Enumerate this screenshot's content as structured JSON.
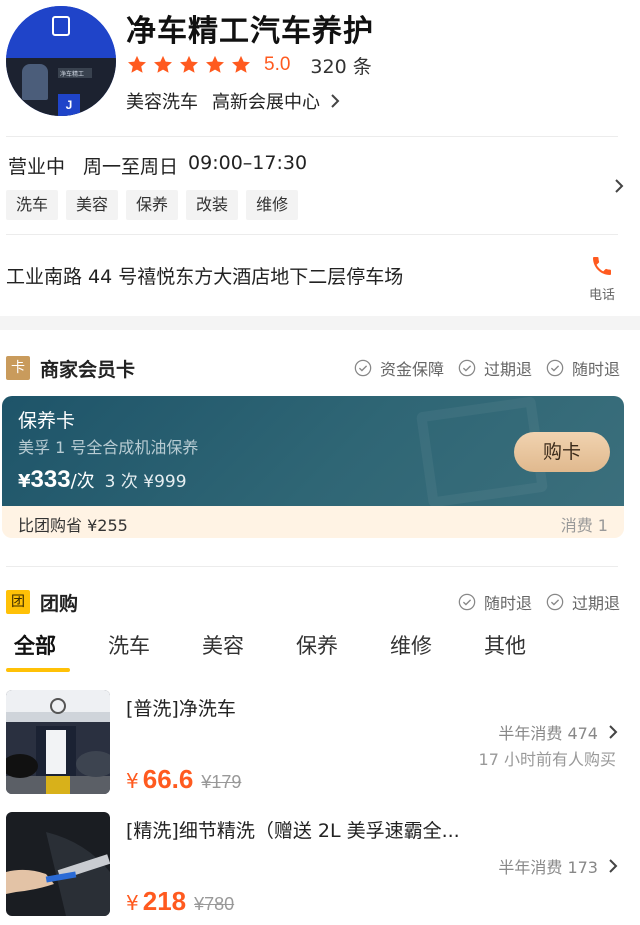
{
  "shop": {
    "name": "净车精工汽车养护",
    "rating": "5.0",
    "stars": 5,
    "reviews": "320 条",
    "category": "美容洗车",
    "district": "高新会展中心",
    "avatar_badge": "J",
    "avatar_sign": "净车精工"
  },
  "hours": {
    "status": "营业中",
    "days": "周一至周日",
    "time": "09:00–17:30",
    "tags": [
      "洗车",
      "美容",
      "保养",
      "改装",
      "维修"
    ]
  },
  "address": {
    "text": "工业南路 44 号禧悦东方大酒店地下二层停车场",
    "phone_label": "电话"
  },
  "member_card": {
    "badge": "卡",
    "title": "商家会员卡",
    "guarantees": [
      "资金保障",
      "过期退",
      "随时退"
    ],
    "card": {
      "name": "保养卡",
      "desc": "美孚 1 号全合成机油保养",
      "yen": "¥",
      "unit_price": "333",
      "unit": "/次",
      "package": "3 次 ¥999",
      "buy_label": "购卡",
      "save_text": "比团购省 ¥255",
      "consume_text": "消费 1"
    }
  },
  "group_buy": {
    "badge": "团",
    "title": "团购",
    "guarantees": [
      "随时退",
      "过期退"
    ],
    "tabs": [
      "全部",
      "洗车",
      "美容",
      "保养",
      "维修",
      "其他"
    ],
    "deals": [
      {
        "title": "[普洗]净洗车",
        "sales": "半年消费 474",
        "recent": "17 小时前有人购买",
        "yen": "¥",
        "price": "66.6",
        "original": "¥179"
      },
      {
        "title": "[精洗]细节精洗（赠送 2L 美孚速霸全...",
        "sales": "半年消费 173",
        "recent": "",
        "yen": "¥",
        "price": "218",
        "original": "¥780"
      }
    ]
  },
  "colors": {
    "accent_orange": "#ff5a1f",
    "tab_underline": "#ffc107",
    "card_bg": "#2f6675",
    "card_badge": "#c99b5c",
    "group_badge": "#ffc107"
  }
}
